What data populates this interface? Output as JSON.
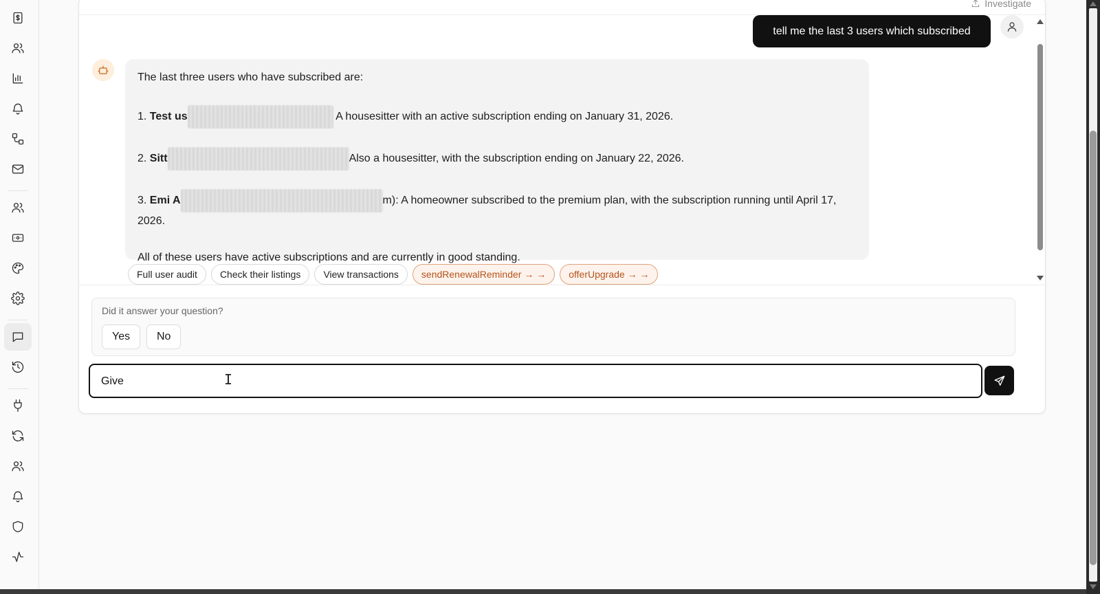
{
  "header": {
    "investigate_label": "Investigate"
  },
  "sidebar": {
    "icons": [
      "dollar-document-icon",
      "users-icon",
      "bar-chart-icon",
      "bell-icon",
      "workflow-icon",
      "mail-icon",
      "team-icon",
      "ticket-icon",
      "palette-icon",
      "gear-icon",
      "chat-icon",
      "history-icon",
      "plug-icon",
      "refresh-icon",
      "people-icon",
      "bell-alt-icon",
      "shield-icon",
      "activity-icon"
    ],
    "active": "chat-icon"
  },
  "chat": {
    "user_message": "tell me the last 3 users which subscribed",
    "bot_message": {
      "intro": "The last three users who have subscribed are:",
      "item1_num": "1.",
      "item1_name": "Test us",
      "item1_text": "A housesitter with an active subscription ending on January 31, 2026.",
      "item2_num": "2.",
      "item2_name": "Sitt",
      "item2_text": "Also a housesitter, with the subscription ending on January 22, 2026.",
      "item3_num": "3.",
      "item3_name": "Emi A",
      "item3_text": "m): A homeowner subscribed to the premium plan, with the subscription running until April 17, 2026.",
      "outro": "All of these users have active subscriptions and are currently in good standing."
    },
    "suggestions": [
      {
        "label": "Full user audit",
        "style": "default"
      },
      {
        "label": "Check their listings",
        "style": "default"
      },
      {
        "label": "View transactions",
        "style": "default"
      },
      {
        "label": "sendRenewalReminder → →",
        "style": "orange"
      },
      {
        "label": "offerUpgrade → →",
        "style": "orange"
      }
    ]
  },
  "feedback": {
    "question": "Did it answer your question?",
    "yes_label": "Yes",
    "no_label": "No"
  },
  "composer": {
    "value": "Give"
  },
  "colors": {
    "accent_orange": "#b5531b",
    "user_bubble": "#111111",
    "bot_bubble": "#f3f3f3"
  }
}
